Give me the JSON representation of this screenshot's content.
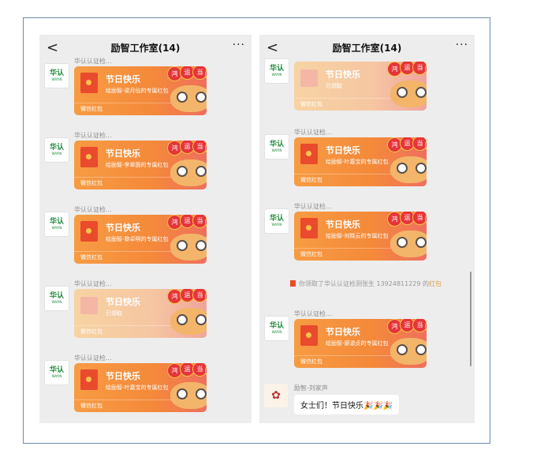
{
  "panel1": {
    "title": "励智工作室(14)",
    "back_glyph": "<",
    "more_glyph": "···",
    "messages": [
      {
        "sender": "华认认证检...",
        "title": "节日快乐",
        "sub": "给励智-梁月仙的专属红包",
        "foot": "微信红包",
        "opened": false
      },
      {
        "sender": "华认认证检...",
        "title": "节日快乐",
        "sub": "给励智-李翠茵的专属红包",
        "foot": "微信红包",
        "opened": false
      },
      {
        "sender": "华认认证检...",
        "title": "节日快乐",
        "sub": "给励智-黎卓明的专属红包",
        "foot": "微信红包",
        "opened": false
      },
      {
        "sender": "华认认证检...",
        "title": "节日快乐",
        "sub": "已领取",
        "foot": "微信红包",
        "opened": true
      },
      {
        "sender": "华认认证检...",
        "title": "节日快乐",
        "sub": "给励智-叶嘉宝的专属红包",
        "foot": "微信红包",
        "opened": false
      }
    ]
  },
  "panel2": {
    "title": "励智工作室(14)",
    "back_glyph": "<",
    "more_glyph": "···",
    "messages": [
      {
        "sender": "",
        "title": "节日快乐",
        "sub": "已领取",
        "foot": "微信红包",
        "opened": true
      },
      {
        "sender": "华认认证检...",
        "title": "节日快乐",
        "sub": "给励智-叶嘉宝的专属红包",
        "foot": "微信红包",
        "opened": false
      },
      {
        "sender": "华认认证检...",
        "title": "节日快乐",
        "sub": "给励智-何晓云的专属红包",
        "foot": "微信红包",
        "opened": false
      },
      {
        "sender": "华认认证检...",
        "title": "节日快乐",
        "sub": "给励智-廖淑贞的专属红包",
        "foot": "微信红包",
        "opened": false
      }
    ],
    "system": {
      "text": "你领取了华认认证检测张生 13924811229 的",
      "link": "红包"
    },
    "chat": {
      "sender": "励智-刘家声",
      "text": "女士们！节日快乐🎉🎉🎉"
    }
  },
  "avatar": {
    "top": "华认",
    "bottom": "WAYIN"
  },
  "lion_text": [
    "鸿",
    "运",
    "当",
    "头"
  ],
  "colors": {
    "card": "#f4893a",
    "envelope": "#e94b2c",
    "link": "#d9a33a",
    "avatar_green": "#1e8a3a"
  }
}
